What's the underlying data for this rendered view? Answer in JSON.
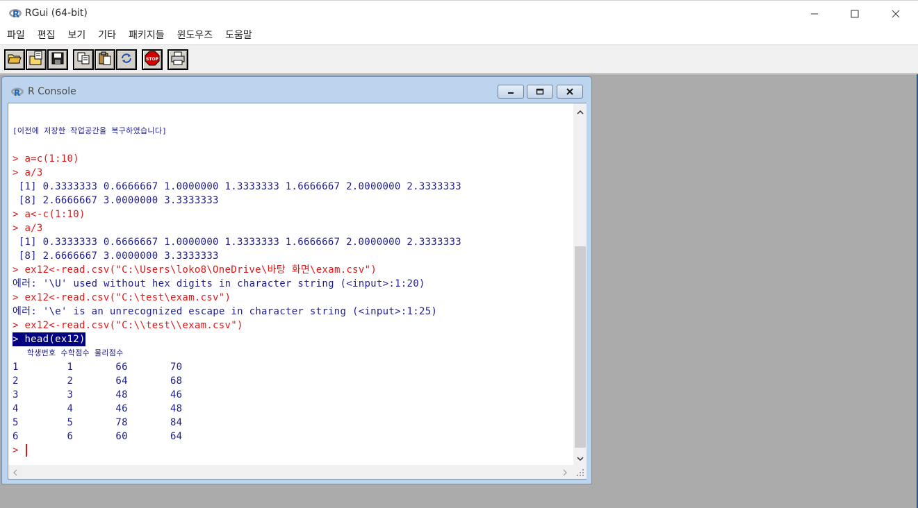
{
  "app": {
    "title": "RGui (64-bit)",
    "menu": [
      "파일",
      "편집",
      "보기",
      "기타",
      "패키지들",
      "윈도우즈",
      "도움말"
    ],
    "toolbar": [
      {
        "icon": "open-script-icon"
      },
      {
        "icon": "load-workspace-icon"
      },
      {
        "icon": "save-workspace-icon"
      },
      {
        "icon": "copy-icon"
      },
      {
        "icon": "paste-icon"
      },
      {
        "icon": "copy-paste-icon"
      },
      {
        "icon": "stop-icon",
        "label": "STOP"
      },
      {
        "icon": "print-icon"
      }
    ]
  },
  "console": {
    "title": "R Console",
    "lines": [
      {
        "type": "notice",
        "text": "[이전에 저장한 작업공간을 복구하였습니다]"
      },
      {
        "type": "blank",
        "text": ""
      },
      {
        "type": "cmd",
        "text": "> a=c(1:10)"
      },
      {
        "type": "cmd",
        "text": "> a/3"
      },
      {
        "type": "out",
        "text": " [1] 0.3333333 0.6666667 1.0000000 1.3333333 1.6666667 2.0000000 2.3333333"
      },
      {
        "type": "out",
        "text": " [8] 2.6666667 3.0000000 3.3333333"
      },
      {
        "type": "cmd",
        "text": "> a<-c(1:10)"
      },
      {
        "type": "cmd",
        "text": "> a/3"
      },
      {
        "type": "out",
        "text": " [1] 0.3333333 0.6666667 1.0000000 1.3333333 1.6666667 2.0000000 2.3333333"
      },
      {
        "type": "out",
        "text": " [8] 2.6666667 3.0000000 3.3333333"
      },
      {
        "type": "cmd",
        "text": "> ex12<-read.csv(\"C:\\Users\\loko8\\OneDrive\\바탕 화면\\exam.csv\")"
      },
      {
        "type": "err",
        "text": "에러: '\\U' used without hex digits in character string (<input>:1:20)"
      },
      {
        "type": "cmd",
        "text": "> ex12<-read.csv(\"C:\\test\\exam.csv\")"
      },
      {
        "type": "err",
        "text": "에러: '\\e' is an unrecognized escape in character string (<input>:1:25)"
      },
      {
        "type": "cmd",
        "text": "> ex12<-read.csv(\"C:\\\\test\\\\exam.csv\")"
      },
      {
        "type": "sel",
        "text": "> head(ex12)"
      },
      {
        "type": "hdr",
        "text": "   학생번호 수학점수 물리점수"
      },
      {
        "type": "out",
        "text": "1        1       66       70"
      },
      {
        "type": "out",
        "text": "2        2       64       68"
      },
      {
        "type": "out",
        "text": "3        3       48       46"
      },
      {
        "type": "out",
        "text": "4        4       46       48"
      },
      {
        "type": "out",
        "text": "5        5       78       84"
      },
      {
        "type": "out",
        "text": "6        6       60       64"
      }
    ],
    "prompt": "> "
  }
}
